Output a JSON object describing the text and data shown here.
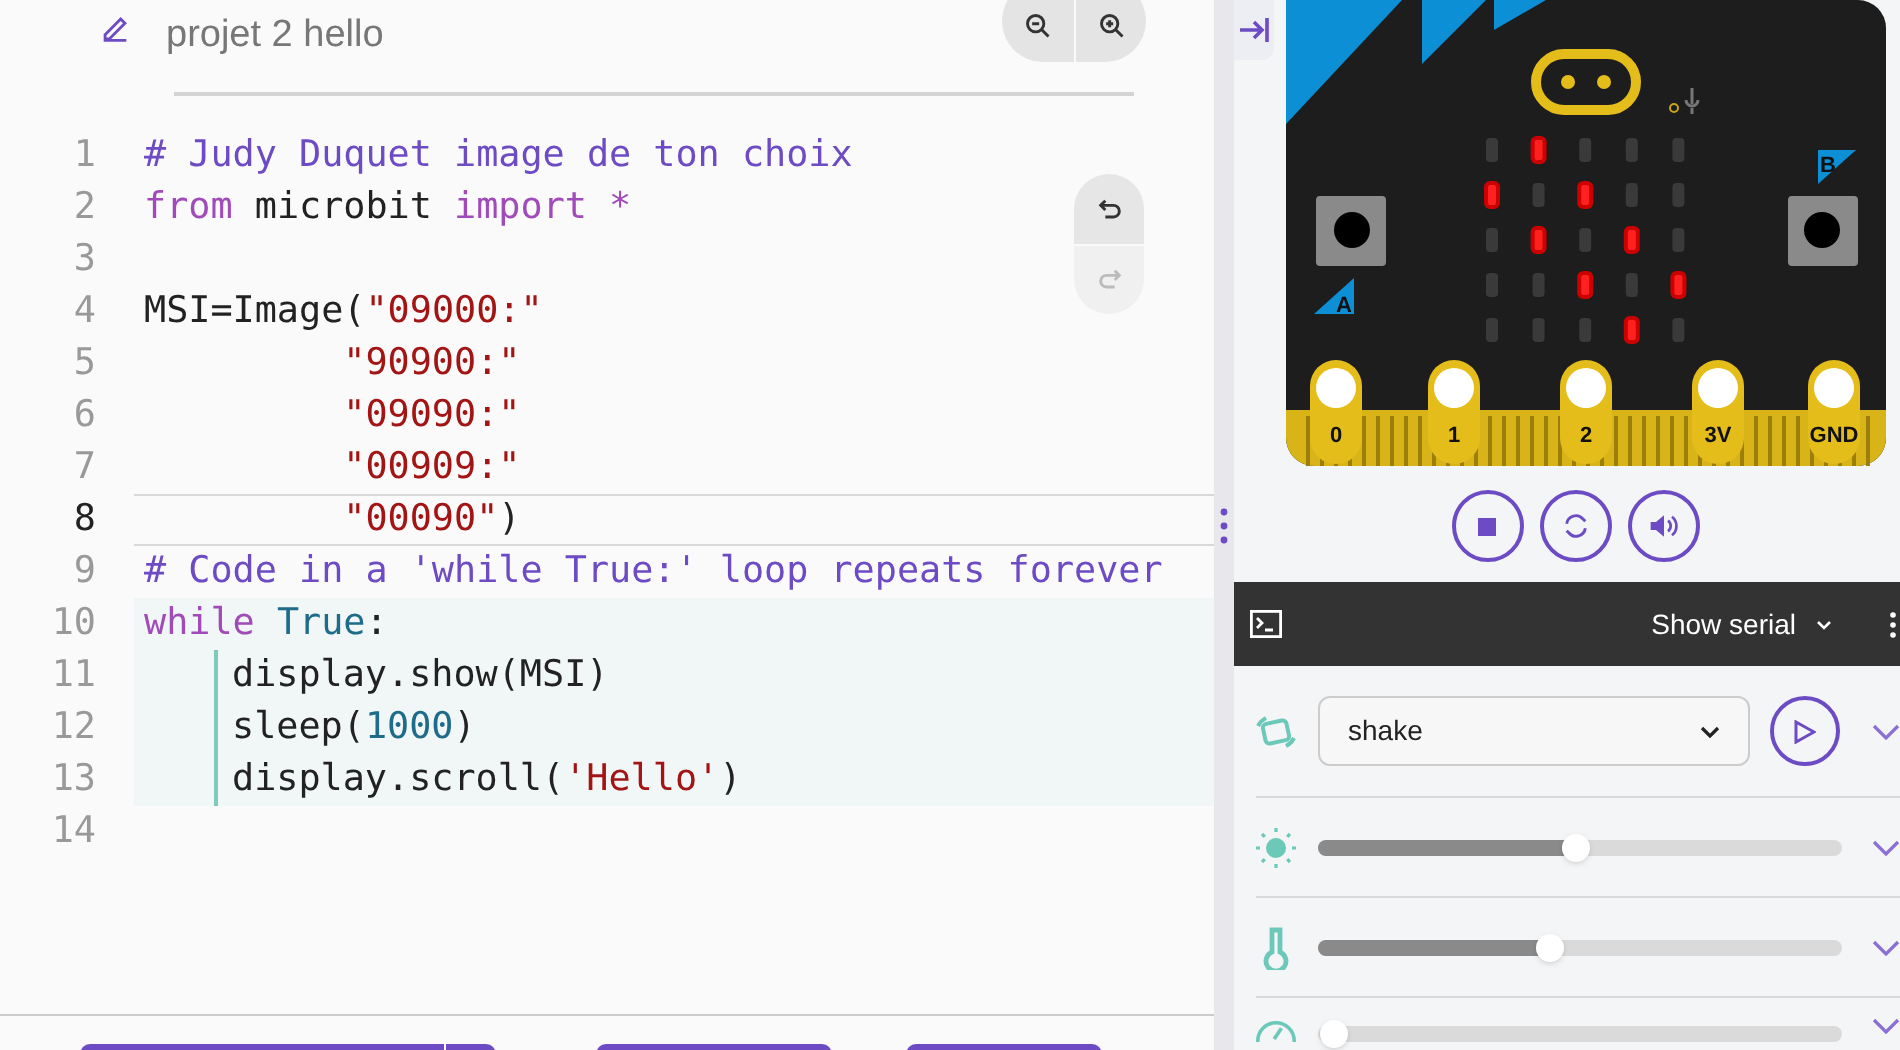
{
  "project": {
    "title": "projet 2 hello"
  },
  "code": {
    "lines": [
      {
        "number": "1",
        "active": false,
        "in_block": false,
        "kind": "plain",
        "tokens": [
          {
            "kind": "comment",
            "text": "# Judy Duquet image de ton choix"
          }
        ]
      },
      {
        "number": "2",
        "active": false,
        "in_block": false,
        "kind": "plain",
        "tokens": [
          {
            "kind": "keyword",
            "text": "from"
          },
          {
            "kind": "plain",
            "text": " microbit "
          },
          {
            "kind": "keyword",
            "text": "import"
          },
          {
            "kind": "keyword",
            "text": " *"
          }
        ]
      },
      {
        "number": "3",
        "active": false,
        "in_block": false,
        "kind": "plain"
      },
      {
        "number": "4",
        "active": false,
        "in_block": false,
        "kind": "plain",
        "tokens": [
          {
            "kind": "plain",
            "text": "MSI=Image("
          },
          {
            "kind": "string",
            "text": "\"09000:\""
          }
        ]
      },
      {
        "number": "5",
        "active": false,
        "in_block": false,
        "kind": "continuation",
        "tokens": [
          {
            "kind": "string",
            "text": "\"90900:\""
          }
        ]
      },
      {
        "number": "6",
        "active": false,
        "in_block": false,
        "kind": "continuation",
        "tokens": [
          {
            "kind": "string",
            "text": "\"09090:\""
          }
        ]
      },
      {
        "number": "7",
        "active": false,
        "in_block": false,
        "kind": "continuation",
        "tokens": [
          {
            "kind": "string",
            "text": "\"00909:\""
          }
        ]
      },
      {
        "number": "8",
        "active": true,
        "in_block": false,
        "kind": "continuation",
        "tokens": [
          {
            "kind": "string",
            "text": "\"00090\""
          },
          {
            "kind": "plain",
            "text": ")"
          }
        ]
      },
      {
        "number": "9",
        "active": false,
        "in_block": false,
        "kind": "plain",
        "tokens": [
          {
            "kind": "comment",
            "text": "# Code in a 'while True:' loop repeats forever"
          }
        ]
      },
      {
        "number": "10",
        "active": false,
        "in_block": true,
        "kind": "plain",
        "tokens": [
          {
            "kind": "keyword",
            "text": "while"
          },
          {
            "kind": "constant",
            "text": " True"
          },
          {
            "kind": "plain",
            "text": ":"
          }
        ]
      },
      {
        "number": "11",
        "active": false,
        "in_block": true,
        "kind": "body",
        "tokens": [
          {
            "kind": "plain",
            "text": "display.show(MSI)"
          }
        ]
      },
      {
        "number": "12",
        "active": false,
        "in_block": true,
        "kind": "body",
        "tokens": [
          {
            "kind": "plain",
            "text": "sleep("
          },
          {
            "kind": "number",
            "text": "1000"
          },
          {
            "kind": "plain",
            "text": ")"
          }
        ]
      },
      {
        "number": "13",
        "active": false,
        "in_block": true,
        "kind": "body",
        "tokens": [
          {
            "kind": "plain",
            "text": "display.scroll("
          },
          {
            "kind": "string",
            "text": "'Hello'"
          },
          {
            "kind": "plain",
            "text": ")"
          }
        ]
      },
      {
        "number": "14",
        "active": false,
        "in_block": false,
        "kind": "plain"
      }
    ]
  },
  "microbit": {
    "leds": [
      [
        false,
        true,
        false,
        false,
        false
      ],
      [
        true,
        false,
        true,
        false,
        false
      ],
      [
        false,
        true,
        false,
        true,
        false
      ],
      [
        false,
        false,
        true,
        false,
        true
      ],
      [
        false,
        false,
        false,
        true,
        false
      ]
    ],
    "button_labels": [
      "A",
      "B"
    ],
    "pins": [
      "0",
      "1",
      "2",
      "3V",
      "GND"
    ]
  },
  "serial": {
    "label": "Show serial"
  },
  "sensors": [
    {
      "kind": "gesture",
      "value": "shake"
    },
    {
      "kind": "light",
      "level": 0.5
    },
    {
      "kind": "temperature",
      "level": 0.45
    },
    {
      "kind": "compass",
      "level": 0.0
    }
  ]
}
